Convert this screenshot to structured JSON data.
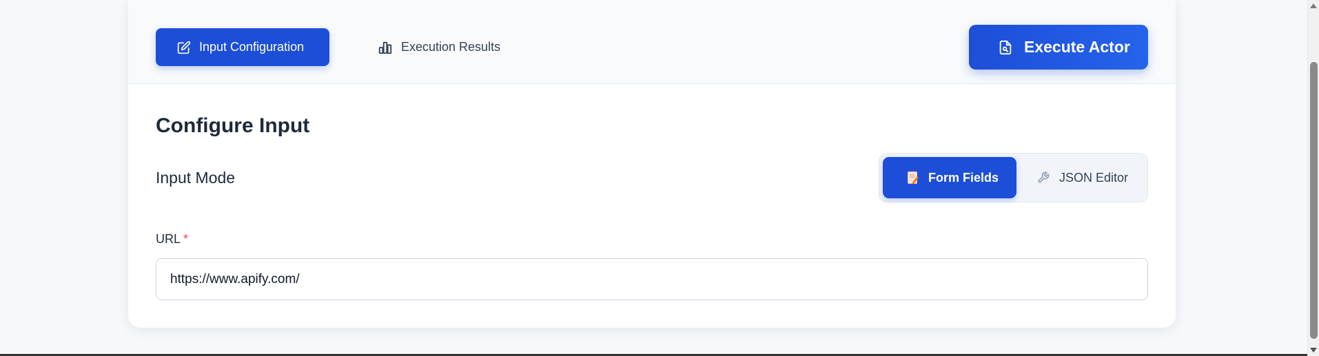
{
  "tabs": {
    "input_configuration": "Input Configuration",
    "execution_results": "Execution Results"
  },
  "execute_button": "Execute Actor",
  "section_title": "Configure Input",
  "input_mode": {
    "label": "Input Mode",
    "form_fields": "Form Fields",
    "json_editor": "JSON Editor",
    "selected": "Form Fields"
  },
  "url_field": {
    "label": "URL",
    "required_marker": "*",
    "value": "https://www.apify.com/"
  },
  "icons": {
    "input_configuration": "edit-icon",
    "execution_results": "bar-chart-icon",
    "execute": "document-search-icon",
    "form_fields": "memo-icon",
    "json_editor": "wrench-icon"
  },
  "colors": {
    "primary": "#1d4ed8",
    "required": "#ef4444",
    "page_background": "#f6f8fb"
  }
}
